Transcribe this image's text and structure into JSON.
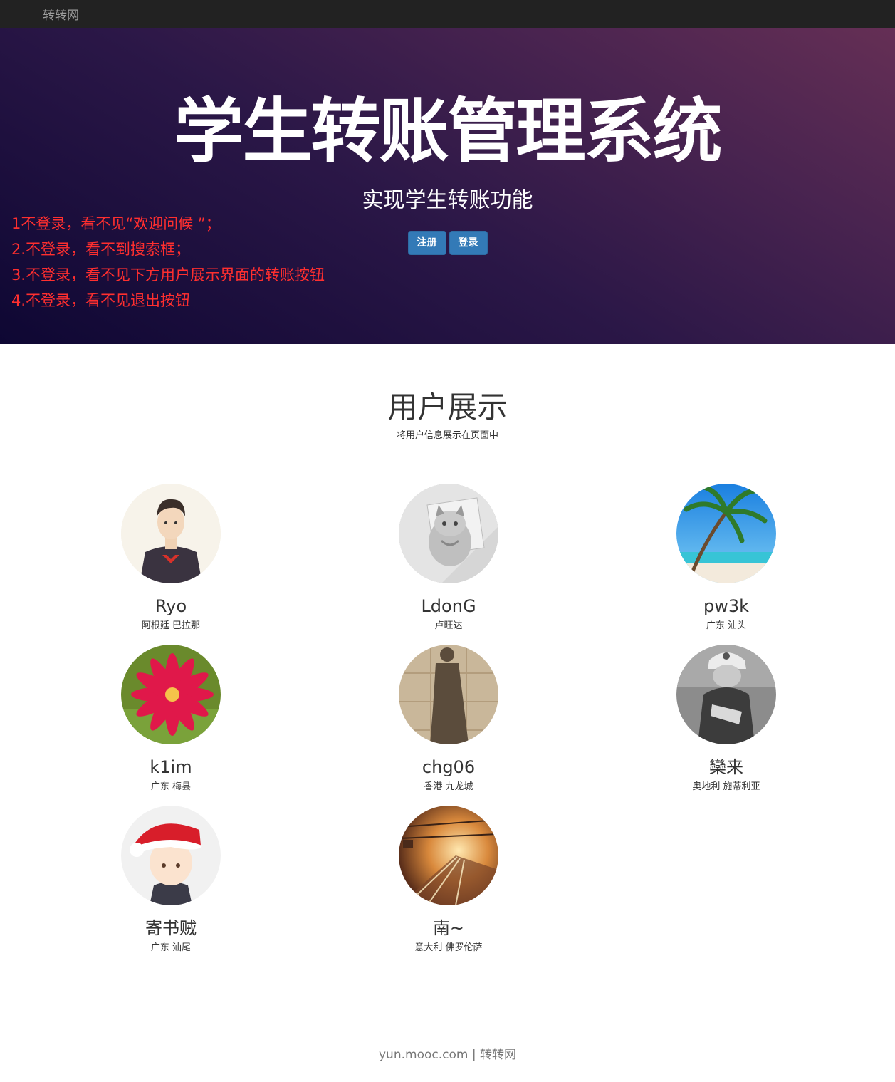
{
  "navbar": {
    "brand": "转转网"
  },
  "hero": {
    "title": "学生转账管理系统",
    "subtitle": "实现学生转账功能",
    "register_label": "注册",
    "login_label": "登录",
    "notes": [
      "1不登录，看不见“欢迎问候 ”；",
      "2.不登录，看不到搜索框；",
      "3.不登录，看不见下方用户展示界面的转账按钮",
      "4.不登录，看不见退出按钮"
    ]
  },
  "section": {
    "title": "用户展示",
    "subtitle": "将用户信息展示在页面中"
  },
  "users": [
    {
      "name": "Ryo",
      "location": "阿根廷 巴拉那",
      "avatar": "anime-boy-avatar"
    },
    {
      "name": "LdonG",
      "location": "卢旺达",
      "avatar": "cat-avatar"
    },
    {
      "name": "pw3k",
      "location": "广东 汕头",
      "avatar": "palm-beach-avatar"
    },
    {
      "name": "k1im",
      "location": "广东 梅县",
      "avatar": "red-flower-avatar"
    },
    {
      "name": "chg06",
      "location": "香港 九龙城",
      "avatar": "shadow-avatar"
    },
    {
      "name": "欒来",
      "location": "奥地利 施蒂利亚",
      "avatar": "cap-girl-avatar"
    },
    {
      "name": "寄书贼",
      "location": "广东 汕尾",
      "avatar": "santa-hat-avatar"
    },
    {
      "name": "南~",
      "location": "意大利 佛罗伦萨",
      "avatar": "train-station-avatar"
    }
  ],
  "footer": {
    "site": "yun.mooc.com",
    "separator": "|",
    "brand": "转转网"
  },
  "colors": {
    "navbar": "#222222",
    "primary_button": "#337ab7",
    "notes": "#ff2f2f",
    "hero_start": "#0e0733",
    "hero_end": "#652f55"
  }
}
